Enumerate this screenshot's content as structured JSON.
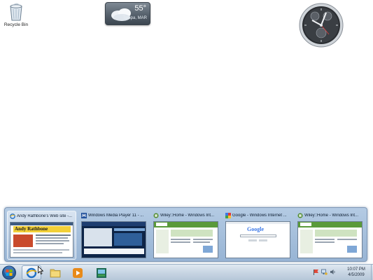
{
  "desktop": {
    "recycle_bin_label": "Recycle Bin"
  },
  "weather_gadget": {
    "temperature": "55°",
    "location": "Tampa, MAR"
  },
  "clock_gadget": {
    "icon": "analog-clock-icon"
  },
  "peek": {
    "thumbnails": [
      {
        "title": "Andy Rathbone's Web site -...",
        "icon": "ie-icon",
        "banner": "Andy Rathbone"
      },
      {
        "title": "Windows Media Player 11 - ...",
        "icon": "wmp-site-icon"
      },
      {
        "title": "Wiley::Home - Windows Int...",
        "icon": "wiley-icon"
      },
      {
        "title": "Google - Windows Internet ...",
        "icon": "google-icon",
        "logo": "Google"
      },
      {
        "title": "Wiley::Home - Windows Int...",
        "icon": "wiley-icon"
      }
    ]
  },
  "taskbar": {
    "buttons": [
      {
        "name": "internet-explorer",
        "icon": "ie-icon",
        "active": true
      },
      {
        "name": "windows-explorer",
        "icon": "folder-icon",
        "active": false
      },
      {
        "name": "media-player",
        "icon": "media-player-icon",
        "active": false
      },
      {
        "name": "media-center",
        "icon": "media-center-icon",
        "active": false
      }
    ],
    "time": "10:07 PM",
    "date": "4/5/2009"
  },
  "colors": {
    "taskbar": "#c9d6e4",
    "peek_bg": "#a8c0dc",
    "wiley_green": "#5a9a3a",
    "ie_blue": "#1f6fc4"
  }
}
